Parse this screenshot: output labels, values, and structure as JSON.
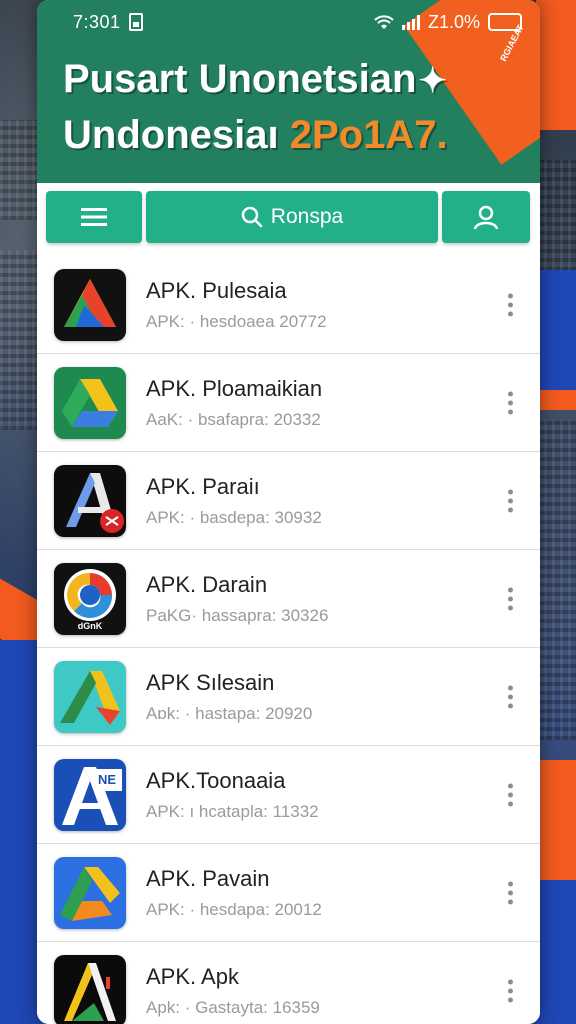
{
  "status_bar": {
    "time": "7:301",
    "battery": "Z1.0%"
  },
  "header": {
    "title_line1": "Pusart Unonetsian",
    "title_line2_main": "Undonesiaı",
    "title_line2_accent": "2Po1A7.",
    "corner_badge": "RGIAEAT",
    "colors": {
      "header_bg": "#23805f",
      "accent_orange": "#f28a2a",
      "corner": "#f2601f",
      "toolbar_btn": "#22b08a"
    }
  },
  "toolbar": {
    "menu_icon": "hamburger-icon",
    "search_icon": "search-icon",
    "search_label": "Ronspa",
    "user_icon": "user-icon"
  },
  "apps": [
    {
      "name": "APK. Pulesaia",
      "sub": "APK: · hesdoaea 20772",
      "icon": "drive-style-logo-dark"
    },
    {
      "name": "APK. Ploamaikian",
      "sub": "AaK: · bsafapra: 20332",
      "icon": "drive-style-logo-green"
    },
    {
      "name": "APK. Paraiı",
      "sub": "APK: · basdepa: 30932",
      "icon": "letter-a-logo-dark"
    },
    {
      "name": "APK. Darain",
      "sub": "PaKG· hassapra: 30326",
      "icon": "ring-logo-dark",
      "icon_text": "dGnK"
    },
    {
      "name": "APK Sılesain",
      "sub": "Aɒk: · hastapa: 20920",
      "icon": "triangle-logo-teal"
    },
    {
      "name": "APK.Toonaaia",
      "sub": "APK: ı hcatapla: 11332",
      "icon": "letter-a-logo-blue",
      "icon_text": "NE"
    },
    {
      "name": "APK. Pavain",
      "sub": "APK: · hesdapa: 20012",
      "icon": "triangle-logo-blue"
    },
    {
      "name": "APK. Apk",
      "sub": "Apk: · Gastayta: 16359",
      "icon": "letter-a-logo-black"
    }
  ]
}
